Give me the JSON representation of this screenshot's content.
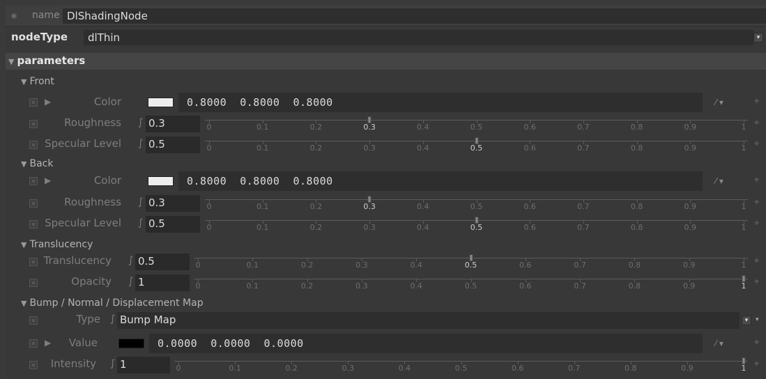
{
  "name_row": {
    "label": "name",
    "value": "DlShadingNode"
  },
  "nodetype_row": {
    "label": "nodeType",
    "value": "dlThin"
  },
  "params": {
    "label": "parameters"
  },
  "sections": {
    "front": "Front",
    "back": "Back",
    "translucency": "Translucency",
    "bump": "Bump / Normal / Displacement Map"
  },
  "front": {
    "color": {
      "label": "Color",
      "swatch": "#eeeeee",
      "r": "0.8000",
      "g": "0.8000",
      "b": "0.8000"
    },
    "roughness": {
      "label": "Roughness",
      "value": "0.3",
      "level": 0.3
    },
    "specular": {
      "label": "Specular Level",
      "value": "0.5",
      "level": 0.5
    }
  },
  "back": {
    "color": {
      "label": "Color",
      "swatch": "#eeeeee",
      "r": "0.8000",
      "g": "0.8000",
      "b": "0.8000"
    },
    "roughness": {
      "label": "Roughness",
      "value": "0.3",
      "level": 0.3
    },
    "specular": {
      "label": "Specular Level",
      "value": "0.5",
      "level": 0.5
    }
  },
  "translucency": {
    "translucency": {
      "label": "Translucency",
      "value": "0.5",
      "level": 0.5
    },
    "opacity": {
      "label": "Opacity",
      "value": "1",
      "level": 1
    }
  },
  "bump": {
    "type": {
      "label": "Type",
      "value": "Bump Map"
    },
    "value": {
      "label": "Value",
      "swatch": "#000000",
      "r": "0.0000",
      "g": "0.0000",
      "b": "0.0000"
    },
    "intensity": {
      "label": "Intensity",
      "value": "1",
      "level": 1
    }
  },
  "slider_ticks": [
    "0",
    "0.1",
    "0.2",
    "0.3",
    "0.4",
    "0.5",
    "0.6",
    "0.7",
    "0.8",
    "0.9",
    "1"
  ],
  "icons": {
    "expression": "∫",
    "pick": "⁄ ▾",
    "pin": "⌖",
    "dropdown": "▾",
    "expand": "▶",
    "section_toggle": "▼"
  },
  "colors": {
    "background": "#383838",
    "field": "#2e2e2e",
    "text": "#dcdcdc",
    "label": "#7e7e7e"
  }
}
